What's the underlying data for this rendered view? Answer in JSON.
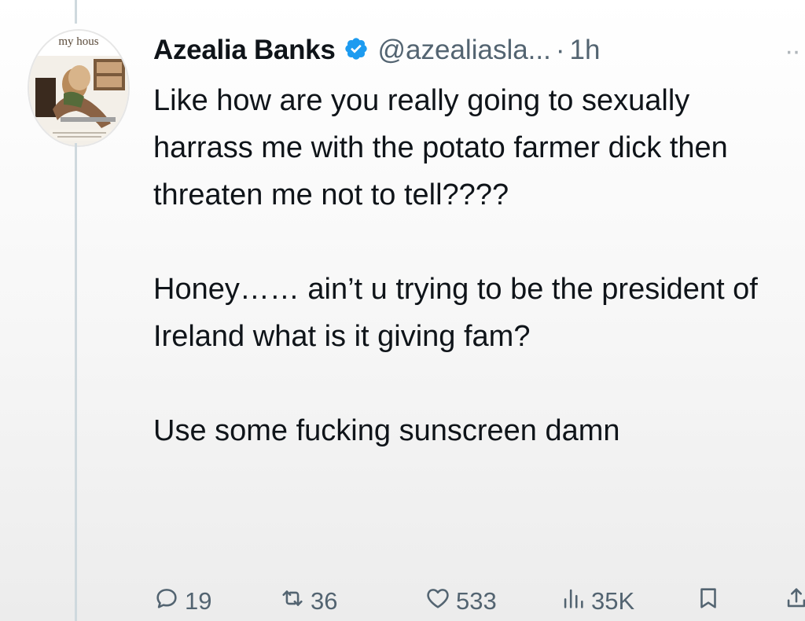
{
  "tweet": {
    "author": {
      "display_name": "Azealia Banks",
      "handle": "@azealiasla...",
      "verified_icon": "verified-badge-icon",
      "avatar_text": "my hous"
    },
    "separator": "·",
    "time": "1h",
    "more_glyph": "··",
    "paragraphs": [
      "Like how are you really going to sexually harrass me with the potato farmer dick then threaten me not to tell????",
      "Honey…… ain’t u trying to be the president of Ireland what is it giving fam?",
      "Use some fucking sunscreen damn"
    ],
    "actions": {
      "replies": "19",
      "reposts": "36",
      "likes": "533",
      "views": "35K"
    },
    "colors": {
      "text": "#0f1419",
      "secondary": "#536471",
      "verified": "#1d9bf0",
      "thread_line": "#cfd9de"
    }
  }
}
